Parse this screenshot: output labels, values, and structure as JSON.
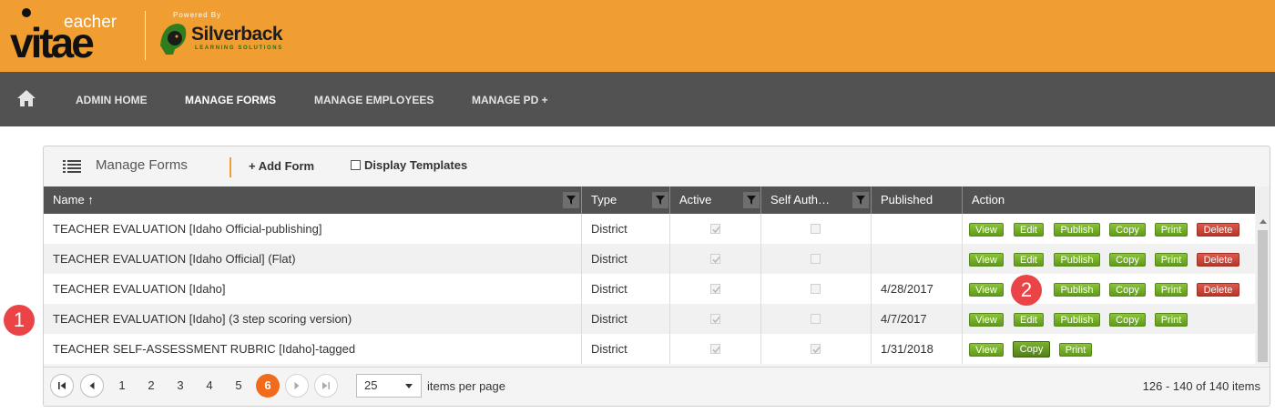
{
  "brand": {
    "logo_top": "eacher",
    "logo_main": "vitae",
    "powered_by": "Powered By",
    "partner_name": "Silverback",
    "partner_sub": "LEARNING SOLUTIONS"
  },
  "nav": {
    "items": [
      {
        "label": "ADMIN HOME"
      },
      {
        "label": "MANAGE FORMS"
      },
      {
        "label": "MANAGE EMPLOYEES"
      },
      {
        "label": "MANAGE PD +"
      }
    ]
  },
  "markers": {
    "one": "1",
    "two": "2"
  },
  "toolbar": {
    "title": "Manage Forms",
    "add_form": "+ Add Form",
    "display_templates": "Display Templates"
  },
  "grid": {
    "columns": [
      {
        "label": "Name  ↑"
      },
      {
        "label": "Type"
      },
      {
        "label": "Active"
      },
      {
        "label": "Self Auth…"
      },
      {
        "label": "Published"
      },
      {
        "label": "Action"
      }
    ],
    "rows": [
      {
        "name": "TEACHER EVALUATION [Idaho Official-publishing]",
        "type": "District",
        "published": "",
        "active": true,
        "self_auth": false
      },
      {
        "name": "TEACHER EVALUATION [Idaho Official] (Flat)",
        "type": "District",
        "published": "",
        "active": true,
        "self_auth": false
      },
      {
        "name": "TEACHER EVALUATION [Idaho]",
        "type": "District",
        "published": "4/28/2017",
        "active": true,
        "self_auth": false
      },
      {
        "name": "TEACHER EVALUATION [Idaho] (3 step scoring version)",
        "type": "District",
        "published": "4/7/2017",
        "active": true,
        "self_auth": false
      },
      {
        "name": "TEACHER SELF-ASSESSMENT RUBRIC [Idaho]-tagged",
        "type": "District",
        "published": "1/31/2018",
        "active": true,
        "self_auth": true
      }
    ],
    "actions": {
      "view": "View",
      "edit": "Edit",
      "publish": "Publish",
      "copy": "Copy",
      "print": "Print",
      "delete": "Delete"
    }
  },
  "pager": {
    "pages": [
      "1",
      "2",
      "3",
      "4",
      "5",
      "6"
    ],
    "current_page": "6",
    "per_page": "25",
    "per_page_label": "items per page",
    "info": "126 - 140 of 140 items"
  },
  "colors": {
    "header_orange": "#f09d31",
    "nav_gray": "#525252",
    "button_green": "#6fab25",
    "button_red": "#c4412f",
    "current_page_orange": "#f26b1d",
    "marker_red": "#ea4447"
  }
}
